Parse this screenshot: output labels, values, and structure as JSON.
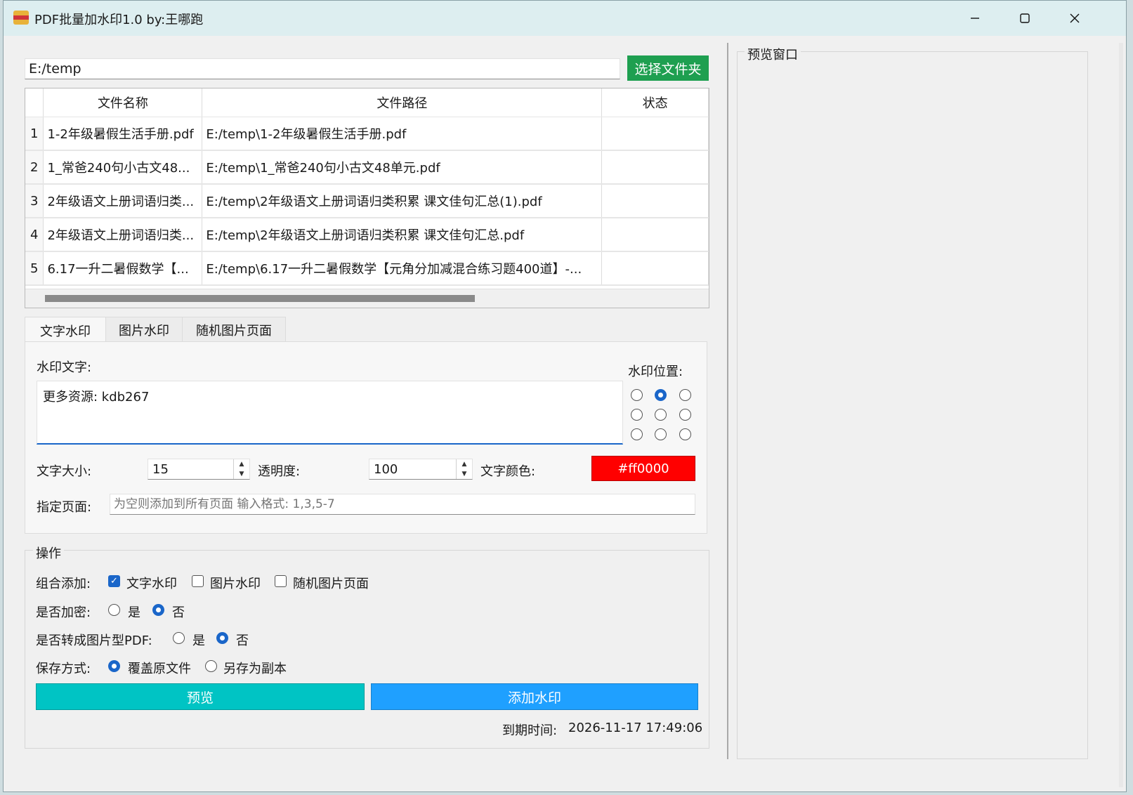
{
  "window": {
    "title": "PDF批量加水印1.0 by:王哪跑",
    "minimize_icon": "minimize-icon",
    "maximize_icon": "maximize-icon",
    "close_icon": "close-icon"
  },
  "folder": {
    "path": "E:/temp",
    "choose_button": "选择文件夹"
  },
  "file_table": {
    "columns": [
      "文件名称",
      "文件路径",
      "状态"
    ],
    "rows": [
      {
        "num": "1",
        "name": "1-2年级暑假生活手册.pdf",
        "path": "E:/temp\\1-2年级暑假生活手册.pdf",
        "status": ""
      },
      {
        "num": "2",
        "name": "1_常爸240句小古文48...",
        "path": "E:/temp\\1_常爸240句小古文48单元.pdf",
        "status": ""
      },
      {
        "num": "3",
        "name": "2年级语文上册词语归类...",
        "path": "E:/temp\\2年级语文上册词语归类积累 课文佳句汇总(1).pdf",
        "status": ""
      },
      {
        "num": "4",
        "name": "2年级语文上册词语归类...",
        "path": "E:/temp\\2年级语文上册词语归类积累 课文佳句汇总.pdf",
        "status": ""
      },
      {
        "num": "5",
        "name": "6.17一升二暑假数学【...",
        "path": "E:/temp\\6.17一升二暑假数学【元角分加减混合练习题400道】-...",
        "status": ""
      }
    ]
  },
  "tabs": [
    "文字水印",
    "图片水印",
    "随机图片页面"
  ],
  "text_watermark": {
    "text_label": "水印文字:",
    "text_value": "更多资源: kdb267",
    "position_label": "水印位置:",
    "position_selected": "top-center",
    "size_label": "文字大小:",
    "size_value": "15",
    "opacity_label": "透明度:",
    "opacity_value": "100",
    "color_label": "文字颜色:",
    "color_value": "#ff0000",
    "pages_label": "指定页面:",
    "pages_placeholder": "为空则添加到所有页面 输入格式: 1,3,5-7"
  },
  "operations": {
    "group_title": "操作",
    "combine_label": "组合添加:",
    "combine_text": "文字水印",
    "combine_image": "图片水印",
    "combine_random": "随机图片页面",
    "encrypt_label": "是否加密:",
    "convert_label": "是否转成图片型PDF:",
    "yes": "是",
    "no": "否",
    "save_label": "保存方式:",
    "save_overwrite": "覆盖原文件",
    "save_copy": "另存为副本",
    "preview_button": "预览",
    "add_button": "添加水印",
    "preview_button_color": "#00c4c4",
    "add_button_color": "#1fa0ff",
    "expiry_label": "到期时间:",
    "expiry_value": "2026-11-17 17:49:06"
  },
  "preview_panel": {
    "title": "预览窗口"
  }
}
